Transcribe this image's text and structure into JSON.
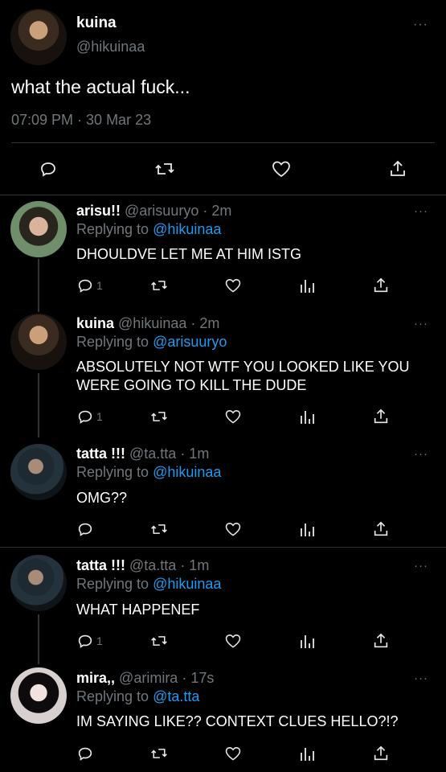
{
  "main_tweet": {
    "name": "kuina",
    "handle": "@hikuinaa",
    "text": "what the actual fuck...",
    "timestamp": "07:09 PM · 30 Mar 23",
    "more": "···"
  },
  "replies": [
    {
      "name": "arisu!!",
      "meta": "@arisuuryo · 2m",
      "replying_label": "Replying to",
      "replying_to": "@hikuinaa",
      "text": "DHOULDVE LET ME AT HIM ISTG",
      "reply_count": "1",
      "more": "···"
    },
    {
      "name": "kuina",
      "meta": "@hikuinaa · 2m",
      "replying_label": "Replying to",
      "replying_to": "@arisuuryo",
      "text": "ABSOLUTELY NOT WTF YOU LOOKED LIKE YOU WERE GOING TO KILL THE DUDE",
      "reply_count": "1",
      "more": "···"
    },
    {
      "name": "tatta !!!",
      "meta": "@ta.tta · 1m",
      "replying_label": "Replying to",
      "replying_to": "@hikuinaa",
      "text": "OMG??",
      "reply_count": "",
      "more": "···"
    },
    {
      "name": "tatta !!!",
      "meta": "@ta.tta · 1m",
      "replying_label": "Replying to",
      "replying_to": "@hikuinaa",
      "text": "WHAT HAPPENEF",
      "reply_count": "1",
      "more": "···"
    },
    {
      "name": "mira,,",
      "meta": "@arimira · 17s",
      "replying_label": "Replying to",
      "replying_to": "@ta.tta",
      "text": "IM SAYING LIKE?? CONTEXT CLUES HELLO?!?",
      "reply_count": "",
      "more": "···"
    }
  ],
  "colors": {
    "background": "#000000",
    "text": "#ffffff",
    "muted": "#71767b",
    "link": "#1d9bf0",
    "divider": "#2f3336"
  }
}
